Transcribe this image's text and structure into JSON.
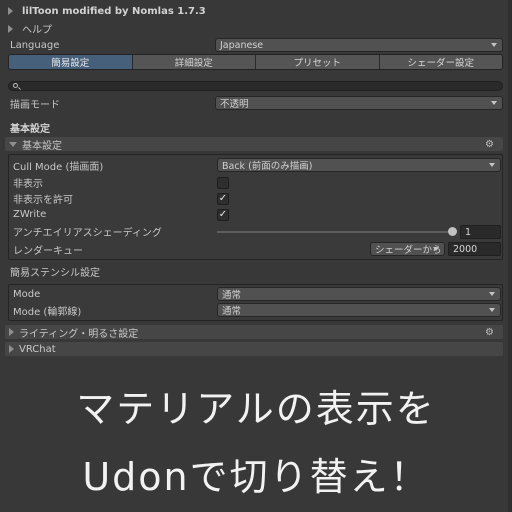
{
  "header": {
    "title": "lilToon modified by Nomlas 1.7.3",
    "help_label": "ヘルプ"
  },
  "language": {
    "label": "Language",
    "value": "Japanese"
  },
  "tabs": [
    {
      "label": "簡易設定",
      "active": true
    },
    {
      "label": "詳細設定",
      "active": false
    },
    {
      "label": "プリセット",
      "active": false
    },
    {
      "label": "シェーダー設定",
      "active": false
    }
  ],
  "search": {
    "value": ""
  },
  "render_mode": {
    "label": "描画モード",
    "value": "不透明"
  },
  "basic_heading": "基本設定",
  "basic_section": {
    "title": "基本設定",
    "cull_mode": {
      "label": "Cull Mode (描画面)",
      "value": "Back (前面のみ描画)"
    },
    "invisible": {
      "label": "非表示",
      "checked": false
    },
    "allow_invisible": {
      "label": "非表示を許可",
      "checked": true
    },
    "zwrite": {
      "label": "ZWrite",
      "checked": true
    },
    "antialias": {
      "label": "アンチエイリアスシェーディング",
      "value": "1"
    },
    "render_queue": {
      "label": "レンダーキュー",
      "preset": "シェーダーから",
      "value": "2000"
    }
  },
  "stencil": {
    "heading": "簡易ステンシル設定",
    "mode": {
      "label": "Mode",
      "value": "通常"
    },
    "mode_outline": {
      "label": "Mode (輪郭線)",
      "value": "通常"
    }
  },
  "lighting_section": {
    "title": "ライティング・明るさ設定"
  },
  "vrchat_section": {
    "title": "VRChat"
  },
  "overlay": {
    "line1": "マテリアルの表示を",
    "line2": "Udonで切り替え！"
  },
  "colors": {
    "background": "#383838",
    "active_tab": "#46607c"
  }
}
